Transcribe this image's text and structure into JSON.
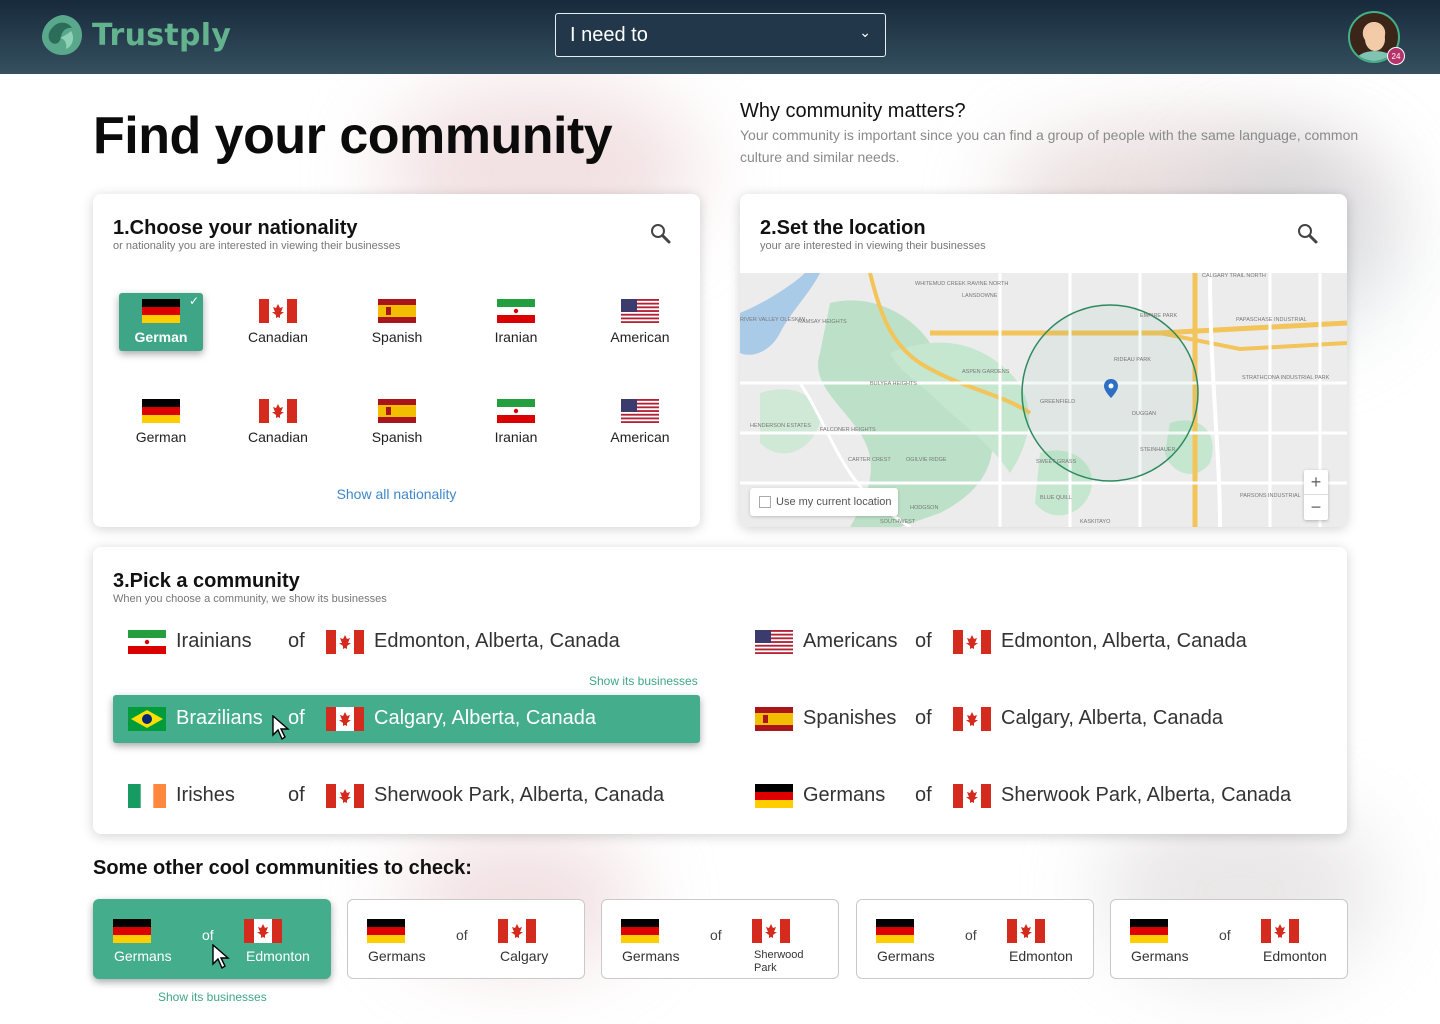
{
  "app": {
    "name": "Trustply",
    "brand_color": "#3ea686",
    "notification_count": "24"
  },
  "header": {
    "need_select": {
      "value": "I need to"
    }
  },
  "hero": {
    "title": "Find your community",
    "why_title": "Why community matters?",
    "why_text": "Your community is important since you can find a group of people with the same language, common culture and similar needs."
  },
  "nationality": {
    "title": "1.Choose your nationality",
    "subtitle": "or nationality you are interested in viewing their businesses",
    "items": [
      {
        "label": "German",
        "flag": "germany-flag",
        "selected": true
      },
      {
        "label": "Canadian",
        "flag": "canada-flag"
      },
      {
        "label": "Spanish",
        "flag": "spain-flag"
      },
      {
        "label": "Iranian",
        "flag": "iran-flag"
      },
      {
        "label": "American",
        "flag": "usa-flag"
      },
      {
        "label": "German",
        "flag": "germany-flag"
      },
      {
        "label": "Canadian",
        "flag": "canada-flag"
      },
      {
        "label": "Spanish",
        "flag": "spain-flag"
      },
      {
        "label": "Iranian",
        "flag": "iran-flag"
      },
      {
        "label": "American",
        "flag": "usa-flag"
      }
    ],
    "show_all": "Show all nationality"
  },
  "location": {
    "title": "2.Set the location",
    "subtitle": "your are interested in viewing their businesses",
    "use_current": "Use my current location",
    "zoom_in": "+",
    "zoom_out": "−",
    "map_labels": [
      "RIVER VALLEY OLESKIW",
      "RAMSAY HEIGHTS",
      "LANSDOWNE",
      "WHITEMUD CREEK RAVINE NORTH",
      "ASPEN GARDENS",
      "GREENFIELD",
      "RIDEAU PARK",
      "EMPIRE PARK",
      "PAPASCHASE INDUSTRIAL",
      "CALGARY TRAIL NORTH",
      "DUGGAN",
      "STEINHAUER",
      "SWEET GRASS",
      "BLUE QUILL",
      "CARTER CREST",
      "FALCONER HEIGHTS",
      "HENDERSON ESTATES",
      "BULYEA HEIGHTS",
      "OGILVIE RIDGE",
      "STRATHCONA INDUSTRIAL PARK",
      "PARSONS INDUSTRIAL",
      "KASKITAYO",
      "HODGSON",
      "SOUTHWEST"
    ]
  },
  "community": {
    "title": "3.Pick a community",
    "subtitle": "When you choose a community, we show its businesses",
    "of_label": "of",
    "show_biz": "Show its businesses",
    "rows": [
      {
        "name": "Irainians",
        "flag": "iran-flag",
        "city": "Edmonton, Alberta, Canada",
        "city_flag": "canada-flag"
      },
      {
        "name": "Americans",
        "flag": "usa-flag",
        "city": "Edmonton, Alberta, Canada",
        "city_flag": "canada-flag"
      },
      {
        "name": "Brazilians",
        "flag": "brazil-flag",
        "city": "Calgary, Alberta, Canada",
        "city_flag": "canada-flag",
        "active": true
      },
      {
        "name": "Spanishes",
        "flag": "spain-flag",
        "city": "Calgary, Alberta, Canada",
        "city_flag": "canada-flag"
      },
      {
        "name": "Irishes",
        "flag": "ireland-flag",
        "city": "Sherwook Park, Alberta, Canada",
        "city_flag": "canada-flag"
      },
      {
        "name": "Germans",
        "flag": "germany-flag",
        "city": "Sherwook Park, Alberta, Canada",
        "city_flag": "canada-flag"
      }
    ]
  },
  "other": {
    "title": "Some other cool communities to check:",
    "of_label": "of",
    "show_biz": "Show its businesses",
    "cards": [
      {
        "left": "Germans",
        "right": "Edmonton",
        "active": true
      },
      {
        "left": "Germans",
        "right": "Calgary"
      },
      {
        "left": "Germans",
        "right": "Sherwood Park"
      },
      {
        "left": "Germans",
        "right": "Edmonton"
      },
      {
        "left": "Germans",
        "right": "Edmonton"
      }
    ]
  }
}
